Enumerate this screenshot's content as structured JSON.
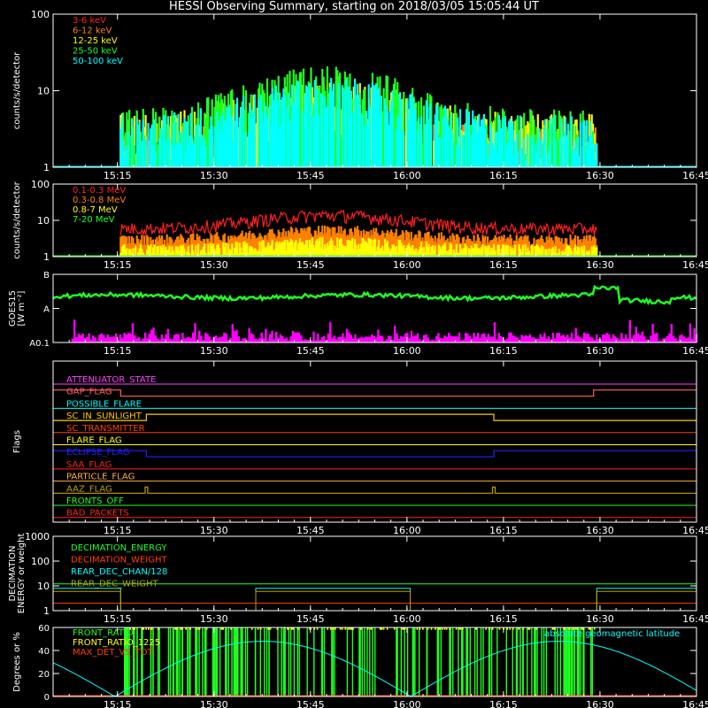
{
  "title": "HESSI Observing Summary, starting on 2018/03/05 15:05:44 UT",
  "colors": {
    "frame": "#ffffff",
    "red": "#ff2020",
    "orange": "#ff8000",
    "yellow": "#ffff00",
    "green": "#20ff20",
    "cyan": "#00ffff",
    "magenta": "#ff00ff",
    "blue": "#2020ff",
    "olive": "#c0a000",
    "orange_red": "#ff4000",
    "gold": "#ffcc00",
    "pink": "#ff6060",
    "salmon": "#ff8060",
    "lightorange": "#ffb040",
    "purple": "#ff40ff"
  },
  "time_axis": {
    "start_min": 0,
    "end_min": 100,
    "tick_labels": [
      "15:15",
      "15:30",
      "15:45",
      "16:00",
      "16:15",
      "16:30",
      "16:45"
    ],
    "tick_positions_min": [
      10,
      25,
      40,
      55,
      70,
      85,
      100
    ]
  },
  "chart_data": [
    {
      "type": "line",
      "name": "lo_energy",
      "ylabel": "counts/s/detector",
      "yscale": "log",
      "ylim": [
        1,
        100
      ],
      "ytick_labels": [
        "1",
        "10",
        "100"
      ],
      "ytick_values": [
        1,
        10,
        100
      ],
      "data_start_min": 10.5,
      "data_end_min": 84.5,
      "series": [
        {
          "name": "3-6 keV",
          "color_key": "red",
          "level": 1.8,
          "peak": 2.2,
          "noise": 0.6
        },
        {
          "name": "6-12 keV",
          "color_key": "orange",
          "level": 2.4,
          "peak": 2.9,
          "noise": 0.5
        },
        {
          "name": "12-25 keV",
          "color_key": "yellow",
          "level": 3.0,
          "peak": 8.0,
          "noise": 0.7
        },
        {
          "name": "25-50 keV",
          "color_key": "green",
          "level": 3.2,
          "peak": 12.0,
          "noise": 0.8
        },
        {
          "name": "50-100 keV",
          "color_key": "cyan",
          "level": 3.0,
          "peak": 9.5,
          "noise": 0.6
        }
      ]
    },
    {
      "type": "line",
      "name": "hi_energy",
      "ylabel": "counts/s/detector",
      "yscale": "log",
      "ylim": [
        1,
        100
      ],
      "ytick_labels": [
        "1",
        "10",
        "100"
      ],
      "ytick_values": [
        1,
        10,
        100
      ],
      "data_start_min": 10.5,
      "data_end_min": 84.5,
      "series": [
        {
          "name": "0.1-0.3 MeV",
          "color_key": "red",
          "level": 6.0,
          "peak": 14.0,
          "noise": 0.4
        },
        {
          "name": "0.3-0.8 MeV",
          "color_key": "orange",
          "level": 3.0,
          "peak": 5.5,
          "noise": 0.35
        },
        {
          "name": "0.8-7 MeV",
          "color_key": "yellow",
          "level": 1.6,
          "peak": 2.5,
          "noise": 0.4
        },
        {
          "name": "7-20 MeV",
          "color_key": "green",
          "level": 1.0,
          "peak": 1.0,
          "noise": 0.0
        }
      ]
    },
    {
      "type": "line",
      "name": "goes",
      "ylabel": "GOES15",
      "ylabel2": "[W m⁻²]",
      "ytick_labels": [
        "A0.1",
        "A",
        "B"
      ],
      "ytick_values": [
        0,
        1,
        2
      ],
      "series": [
        {
          "name": "GOES green",
          "color_key": "green",
          "level": 1.35
        },
        {
          "name": "GOES magenta",
          "color_key": "magenta",
          "level": 0.05
        }
      ]
    },
    {
      "type": "line",
      "name": "flags",
      "ylabel": "Flags",
      "flags": [
        {
          "label": "ATTENUATOR_STATE",
          "color_key": "purple",
          "changes": []
        },
        {
          "label": "GAP_FLAG",
          "color_key": "pink",
          "changes": [
            [
              0,
              1
            ],
            [
              10.5,
              0
            ],
            [
              84,
              1
            ]
          ]
        },
        {
          "label": "POSSIBLE_FLARE",
          "color_key": "cyan",
          "changes": []
        },
        {
          "label": "SC_IN_SUNLIGHT",
          "color_key": "gold",
          "changes": [
            [
              0,
              0
            ],
            [
              14.5,
              1
            ],
            [
              68.5,
              0
            ]
          ]
        },
        {
          "label": "SC_TRANSMITTER",
          "color_key": "orange_red",
          "changes": []
        },
        {
          "label": "FLARE_FLAG",
          "color_key": "yellow",
          "changes": []
        },
        {
          "label": "ECLIPSE_FLAG",
          "color_key": "blue",
          "changes": [
            [
              0,
              1
            ],
            [
              14.5,
              0
            ],
            [
              68.5,
              1
            ]
          ]
        },
        {
          "label": "SAA_FLAG",
          "color_key": "red",
          "changes": []
        },
        {
          "label": "PARTICLE_FLAG",
          "color_key": "lightorange",
          "changes": []
        },
        {
          "label": "AAZ_FLAG",
          "color_key": "olive",
          "changes": [
            [
              0,
              0
            ],
            [
              14.3,
              1
            ],
            [
              14.7,
              0
            ],
            [
              68.3,
              1
            ],
            [
              68.7,
              0
            ]
          ]
        },
        {
          "label": "FRONTS_OFF",
          "color_key": "green",
          "changes": []
        },
        {
          "label": "BAD_PACKETS",
          "color_key": "red",
          "changes": []
        }
      ]
    },
    {
      "type": "line",
      "name": "decimation",
      "ylabel": "DECIMATION",
      "ylabel2": "ENERGY or weight",
      "yscale": "log",
      "ylim": [
        1,
        1000
      ],
      "ytick_labels": [
        "1",
        "10",
        "100",
        "1000"
      ],
      "ytick_values": [
        1,
        10,
        100,
        1000
      ],
      "series": [
        {
          "name": "DECIMATION_ENERGY",
          "color_key": "green",
          "step": [
            [
              0,
              12
            ],
            [
              100,
              12
            ]
          ]
        },
        {
          "name": "DECIMATION_WEIGHT",
          "color_key": "orange_red",
          "step": [
            [
              0,
              2
            ],
            [
              100,
              2
            ]
          ]
        },
        {
          "name": "REAR_DEC_CHAN/128",
          "color_key": "cyan",
          "step": [
            [
              0,
              8
            ],
            [
              10.5,
              1
            ],
            [
              31.5,
              8
            ],
            [
              55.5,
              1
            ],
            [
              84.5,
              8
            ]
          ]
        },
        {
          "name": "REAR_DEC_WEIGHT",
          "color_key": "olive",
          "step": [
            [
              0,
              6
            ],
            [
              10.5,
              1
            ],
            [
              31.5,
              6
            ],
            [
              55.5,
              1
            ],
            [
              84.5,
              6
            ]
          ]
        }
      ]
    },
    {
      "type": "line",
      "name": "ratios",
      "ylabel": "Degrees or %",
      "ylim": [
        0,
        60
      ],
      "ytick_labels": [
        "0",
        "20",
        "40",
        "60"
      ],
      "ytick_values": [
        0,
        20,
        40,
        60
      ],
      "series": [
        {
          "name": "FRONT_RATIO",
          "color_key": "green"
        },
        {
          "name": "FRONT_RATIO_1225",
          "color_key": "yellow"
        },
        {
          "name": "MAX_DET_VS_TOT",
          "color_key": "orange_red"
        },
        {
          "name": "absolute geomagnetic latitude",
          "color_key": "cyan"
        }
      ]
    }
  ]
}
